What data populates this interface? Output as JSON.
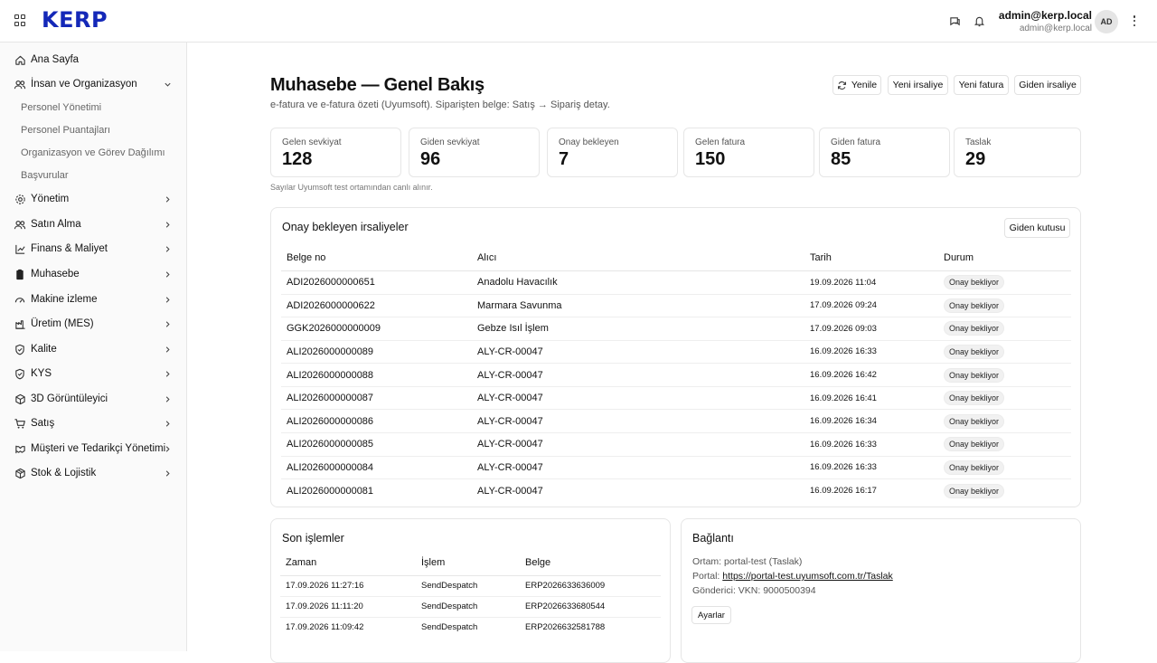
{
  "header": {
    "logo": "KERP",
    "user_email": "admin@kerp.local",
    "user_sub": "admin@kerp.local",
    "avatar": "AD"
  },
  "sidebar": {
    "items": [
      {
        "label": "Ana Sayfa",
        "icon": "home-icon"
      },
      {
        "label": "İnsan ve Organizasyon",
        "icon": "users-icon",
        "expanded": true,
        "children": [
          "Personel Yönetimi",
          "Personel Puantajları",
          "Organizasyon ve Görev Dağılımı",
          "Başvurular"
        ]
      },
      {
        "label": "Yönetim",
        "icon": "gear-icon"
      },
      {
        "label": "Satın Alma",
        "icon": "users-icon"
      },
      {
        "label": "Finans & Maliyet",
        "icon": "chart-icon"
      },
      {
        "label": "Muhasebe",
        "icon": "clipboard-icon"
      },
      {
        "label": "Makine izleme",
        "icon": "gauge-icon"
      },
      {
        "label": "Üretim (MES)",
        "icon": "factory-icon"
      },
      {
        "label": "Kalite",
        "icon": "shield-icon"
      },
      {
        "label": "KYS",
        "icon": "shield-icon"
      },
      {
        "label": "3D Görüntüleyici",
        "icon": "cube-icon"
      },
      {
        "label": "Satış",
        "icon": "cart-icon"
      },
      {
        "label": "Müşteri ve Tedarikçi Yönetimi",
        "icon": "handshake-icon"
      },
      {
        "label": "Stok & Lojistik",
        "icon": "box-icon"
      }
    ]
  },
  "page": {
    "title": "Muhasebe — Genel Bakış",
    "subtitle": "e-fatura ve e-fatura özeti (Uyumsoft). Siparişten belge: Satış → Sipariş detay.",
    "buttons": {
      "refresh": "Yenile",
      "new_despatch": "Yeni irsaliye",
      "new_invoice": "Yeni fatura",
      "outgoing_despatch": "Giden irsaliye"
    },
    "stats": [
      {
        "label": "Gelen sevkiyat",
        "value": "128"
      },
      {
        "label": "Giden sevkiyat",
        "value": "96"
      },
      {
        "label": "Onay bekleyen",
        "value": "7"
      },
      {
        "label": "Gelen fatura",
        "value": "150"
      },
      {
        "label": "Giden fatura",
        "value": "85"
      },
      {
        "label": "Taslak",
        "value": "29"
      }
    ],
    "stats_note": "Sayılar Uyumsoft test ortamından canlı alınır."
  },
  "pending": {
    "title": "Onay bekleyen irsaliyeler",
    "outbox_button": "Giden kutusu",
    "columns": [
      "Belge no",
      "Alıcı",
      "Tarih",
      "Durum"
    ],
    "rows": [
      {
        "doc": "ADI2026000000651",
        "recipient": "Anadolu Havacılık",
        "date": "19.09.2026 11:04",
        "status": "Onay bekliyor"
      },
      {
        "doc": "ADI2026000000622",
        "recipient": "Marmara Savunma",
        "date": "17.09.2026 09:24",
        "status": "Onay bekliyor"
      },
      {
        "doc": "GGK2026000000009",
        "recipient": "Gebze Isıl İşlem",
        "date": "17.09.2026 09:03",
        "status": "Onay bekliyor"
      },
      {
        "doc": "ALI2026000000089",
        "recipient": "ALY-CR-00047",
        "date": "16.09.2026 16:33",
        "status": "Onay bekliyor"
      },
      {
        "doc": "ALI2026000000088",
        "recipient": "ALY-CR-00047",
        "date": "16.09.2026 16:42",
        "status": "Onay bekliyor"
      },
      {
        "doc": "ALI2026000000087",
        "recipient": "ALY-CR-00047",
        "date": "16.09.2026 16:41",
        "status": "Onay bekliyor"
      },
      {
        "doc": "ALI2026000000086",
        "recipient": "ALY-CR-00047",
        "date": "16.09.2026 16:34",
        "status": "Onay bekliyor"
      },
      {
        "doc": "ALI2026000000085",
        "recipient": "ALY-CR-00047",
        "date": "16.09.2026 16:33",
        "status": "Onay bekliyor"
      },
      {
        "doc": "ALI2026000000084",
        "recipient": "ALY-CR-00047",
        "date": "16.09.2026 16:33",
        "status": "Onay bekliyor"
      },
      {
        "doc": "ALI2026000000081",
        "recipient": "ALY-CR-00047",
        "date": "16.09.2026 16:17",
        "status": "Onay bekliyor"
      }
    ]
  },
  "recent": {
    "title": "Son işlemler",
    "columns": [
      "Zaman",
      "İşlem",
      "Belge"
    ],
    "rows": [
      {
        "time": "17.09.2026 11:27:16",
        "op": "SendDespatch",
        "doc": "ERP2026633636009"
      },
      {
        "time": "17.09.2026 11:11:20",
        "op": "SendDespatch",
        "doc": "ERP2026633680544"
      },
      {
        "time": "17.09.2026 11:09:42",
        "op": "SendDespatch",
        "doc": "ERP2026632581788"
      }
    ]
  },
  "connection": {
    "title": "Bağlantı",
    "env_label": "Ortam:",
    "env_value": "portal-test (Taslak)",
    "portal_label": "Portal:",
    "portal_url": "https://portal-test.uyumsoft.com.tr/Taslak",
    "sender_label": "Gönderici:",
    "sender_value": "VKN: 9000500394",
    "settings_button": "Ayarlar"
  }
}
